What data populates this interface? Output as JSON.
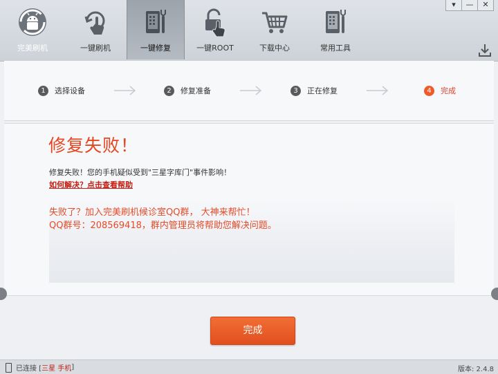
{
  "toolbar": {
    "brand": "完美刷机",
    "tools": [
      {
        "label": "一键刷机",
        "icon": "flash-hand-icon"
      },
      {
        "label": "一键修复",
        "icon": "repair-phone-icon"
      },
      {
        "label": "一键ROOT",
        "icon": "lock-hand-icon"
      },
      {
        "label": "下载中心",
        "icon": "cart-icon"
      },
      {
        "label": "常用工具",
        "icon": "tools-phone-icon"
      }
    ],
    "active_tool": "一键修复",
    "window": {
      "menu": "▾",
      "minimize": "—",
      "close": "✕"
    }
  },
  "steps": [
    {
      "num": "1",
      "label": "选择设备"
    },
    {
      "num": "2",
      "label": "修复准备"
    },
    {
      "num": "3",
      "label": "正在修复"
    },
    {
      "num": "4",
      "label": "完成"
    }
  ],
  "current_step": 4,
  "result": {
    "title": "修复失败！",
    "description": "修复失败！您的手机疑似受到\"三星字库门\"事件影响！",
    "help_link": "如何解决？点击查看帮助",
    "qq_line1": "失败了？加入完美刷机候诊室QQ群， 大神来帮忙！",
    "qq_line2": "QQ群号：208569418，群内管理员将帮助您解决问题。"
  },
  "done_button": "完成",
  "status": {
    "connected": "已连接 [",
    "device": " 三星 手机 ",
    "bracket_close": "]",
    "version": "版本: 2.4.8"
  },
  "colors": {
    "accent": "#f05a2a",
    "error_text": "#e5451f",
    "link": "#c31d12"
  }
}
